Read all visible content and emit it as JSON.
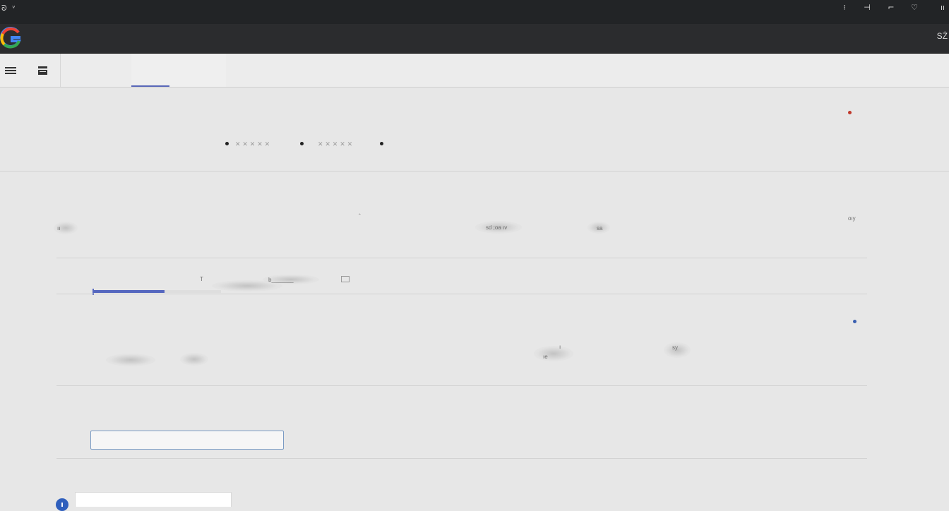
{
  "titlebar": {
    "left_text": "ᘐ ᵛ",
    "controls": [
      "⁝",
      "⊣",
      "⌐",
      "♡",
      "ıı"
    ]
  },
  "appbar": {
    "right_text": "SŻ"
  },
  "row1": {
    "left_label": "ıı",
    "mid_label_a": "ˆ",
    "mid_label_b": "sd ;oa ıv",
    "mid_label_c": "sa",
    "right_label": "oıy"
  },
  "row2": {
    "label_a": "T",
    "label_b": "b_______",
    "progress": 0.56
  },
  "row3": {
    "label_a": "ıe",
    "label_b": "ı",
    "label_c": "sy"
  },
  "info_icon_glyph": "ı",
  "colors": {
    "accent": "#5567bf",
    "red_dot": "#c0392b",
    "blue_dot": "#3a5fb0",
    "titlebar": "#222426",
    "appbar": "#2b2c2e",
    "background": "#e7e7e7"
  }
}
